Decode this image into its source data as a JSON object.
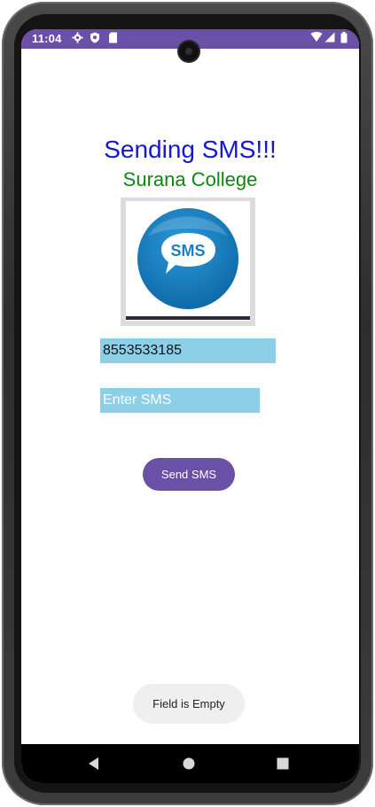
{
  "status_bar": {
    "time": "11:04",
    "color": "#6a50a7",
    "left_icons": [
      "settings-icon",
      "shield-icon",
      "sd-card-icon"
    ],
    "right_icons": [
      "wifi-icon",
      "signal-icon",
      "battery-icon"
    ]
  },
  "app": {
    "title": "Sending SMS!!!",
    "subtitle": "Surana College",
    "title_color": "#1616d6",
    "subtitle_color": "#0a8a0a",
    "logo_text": "SMS",
    "phone_field": {
      "value": "8553533185"
    },
    "message_field": {
      "value": "",
      "placeholder": "Enter SMS"
    },
    "field_color": "#8ecfe8",
    "send_button_label": "Send SMS",
    "accent": "#6a50a7"
  },
  "toast": {
    "text": "Field is Empty"
  },
  "nav_bar": {
    "buttons": [
      "back-icon",
      "home-icon",
      "recents-icon"
    ]
  }
}
